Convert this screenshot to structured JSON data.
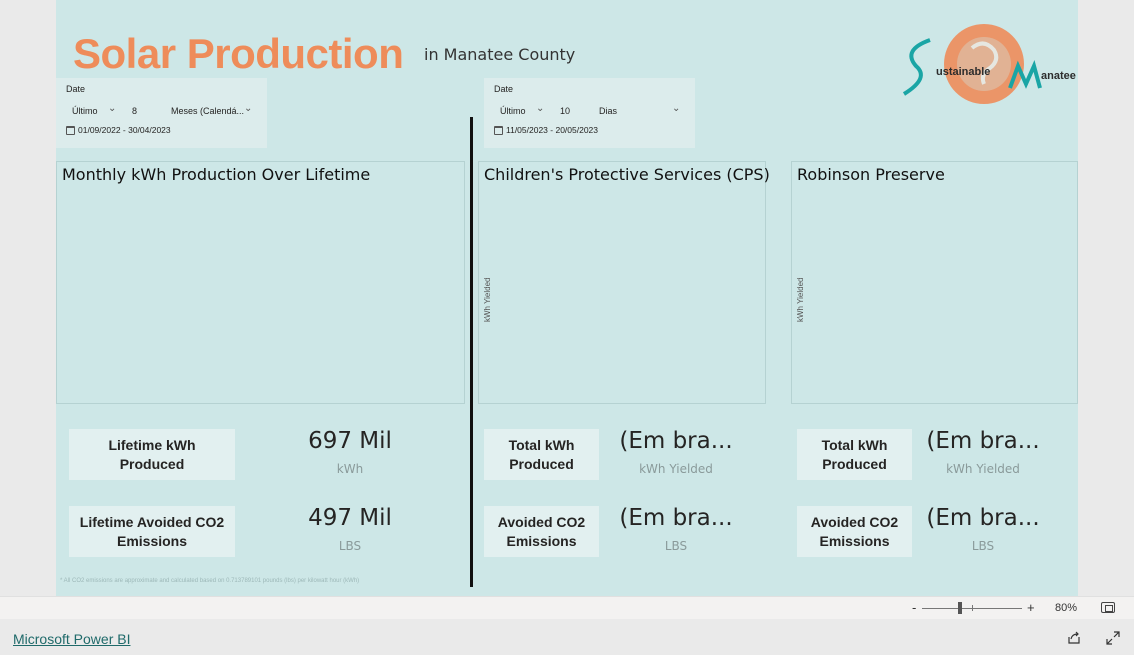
{
  "header": {
    "title": "Solar Production",
    "subtitle": "in Manatee County"
  },
  "logo": {
    "line1_left": "ustainable",
    "line1_right": "anatee",
    "icon_name": "sustainable-manatee-logo"
  },
  "slicers": [
    {
      "label": "Date",
      "mode": "Último",
      "count": "8",
      "unit": "Meses (Calendá...",
      "range": "01/09/2022 - 30/04/2023"
    },
    {
      "label": "Date",
      "mode": "Último",
      "count": "10",
      "unit": "Dias",
      "range": "11/05/2023 - 20/05/2023"
    }
  ],
  "panels": [
    {
      "title": "Monthly kWh Production Over Lifetime",
      "yaxis": ""
    },
    {
      "title": "Children's Protective Services (CPS)",
      "yaxis": "kWh Yielded"
    },
    {
      "title": "Robinson Preserve",
      "yaxis": "kWh Yielded"
    }
  ],
  "kpis": {
    "lifetime": [
      {
        "label": "Lifetime kWh Produced",
        "value": "697 Mil",
        "unit": "kWh"
      },
      {
        "label": "Lifetime Avoided CO2 Emissions",
        "value": "497 Mil",
        "unit": "LBS"
      }
    ],
    "cps": [
      {
        "label": "Total kWh Produced",
        "value": "(Em bra...",
        "unit": "kWh Yielded"
      },
      {
        "label": "Avoided CO2 Emissions",
        "value": "(Em bra...",
        "unit": "LBS"
      }
    ],
    "robinson": [
      {
        "label": "Total kWh Produced",
        "value": "(Em bra...",
        "unit": "kWh Yielded"
      },
      {
        "label": "Avoided CO2 Emissions",
        "value": "(Em bra...",
        "unit": "LBS"
      }
    ]
  },
  "footnote": "* All CO2 emissions are approximate and calculated based on 0.713789101 pounds (lbs) per kilowatt hour (kWh)",
  "zoom": {
    "minus": "-",
    "plus": "+",
    "percent": "80%",
    "level": 0.8
  },
  "footer": {
    "link": "Microsoft Power BI"
  },
  "colors": {
    "canvas": "#cde7e7",
    "title": "#ee8c5a",
    "logo_teal": "#1aa5a5",
    "logo_orange": "#ee8c5a"
  }
}
